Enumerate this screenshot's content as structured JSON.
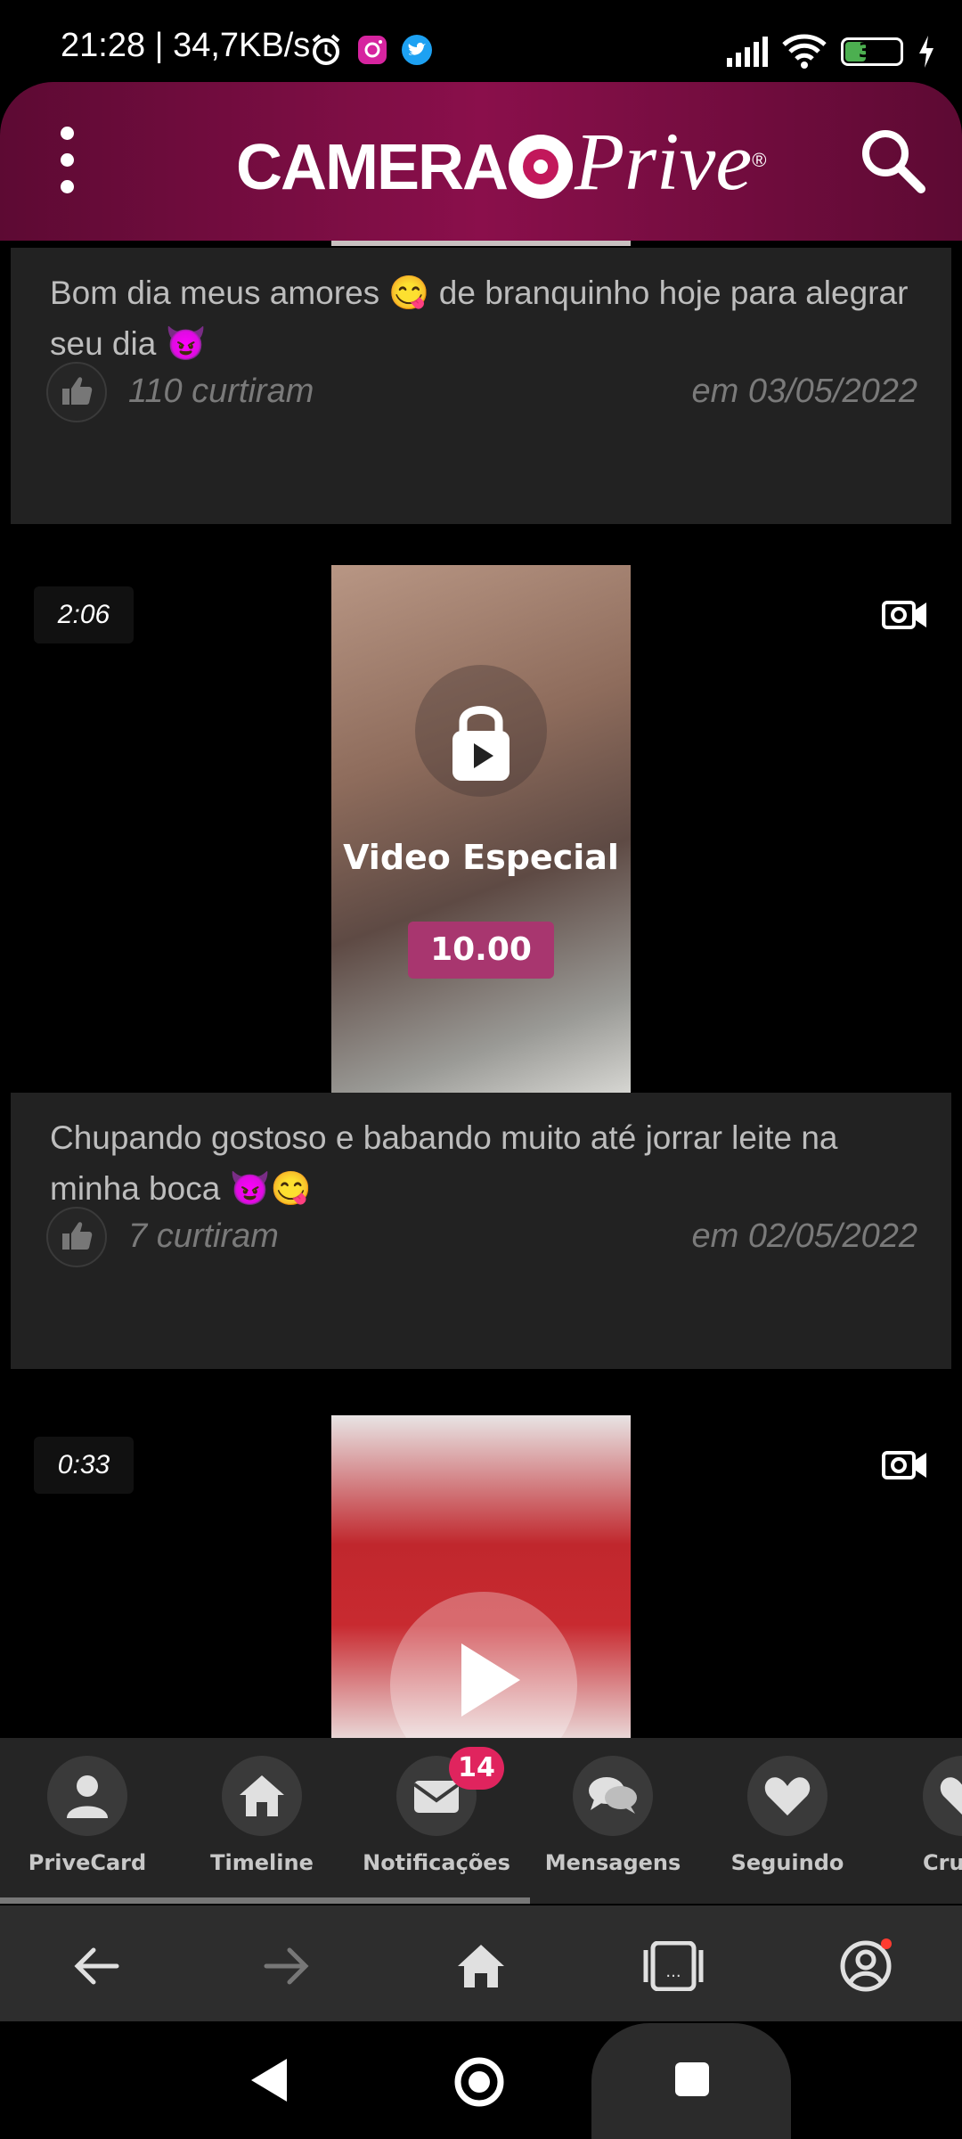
{
  "status_bar": {
    "time_speed": "21:28 | 34,7KB/s",
    "battery": "36",
    "icons": [
      "alarm-icon",
      "instagram-icon",
      "twitter-icon",
      "signal-icon",
      "wifi-icon",
      "battery-icon",
      "charging-icon"
    ]
  },
  "header": {
    "logo_bold": "CAMERA",
    "logo_script": "Prive",
    "logo_reg": "®",
    "menu_icon": "kebab-menu-icon",
    "search_icon": "search-icon"
  },
  "posts": [
    {
      "caption": "Bom dia meus amores 😋 de branquinho hoje para alegrar seu dia 😈",
      "likes": "110 curtiram",
      "date": "em 03/05/2022"
    },
    {
      "duration": "2:06",
      "locked_label": "Video Especial",
      "price": "10.00",
      "caption": "Chupando gostoso e babando muito até jorrar leite na minha boca 😈😋",
      "likes": "7 curtiram",
      "date": "em 02/05/2022"
    },
    {
      "duration": "0:33"
    }
  ],
  "bottom_nav": {
    "items": [
      {
        "label": "PriveCard",
        "icon": "user-icon"
      },
      {
        "label": "Timeline",
        "icon": "home-icon"
      },
      {
        "label": "Notificações",
        "icon": "envelope-icon",
        "badge": "14"
      },
      {
        "label": "Mensagens",
        "icon": "chat-icon"
      },
      {
        "label": "Seguindo",
        "icon": "heart-icon"
      },
      {
        "label": "Crus",
        "icon": "heart-icon"
      }
    ]
  },
  "browser_bar": {
    "icons": [
      "back-arrow-icon",
      "forward-arrow-icon",
      "home-icon",
      "tabs-icon",
      "account-icon"
    ]
  },
  "colors": {
    "header_gradient": "#8a0f4b",
    "price_bg": "#a8366f",
    "badge_bg": "#e0245e",
    "card_bg": "#222222"
  }
}
